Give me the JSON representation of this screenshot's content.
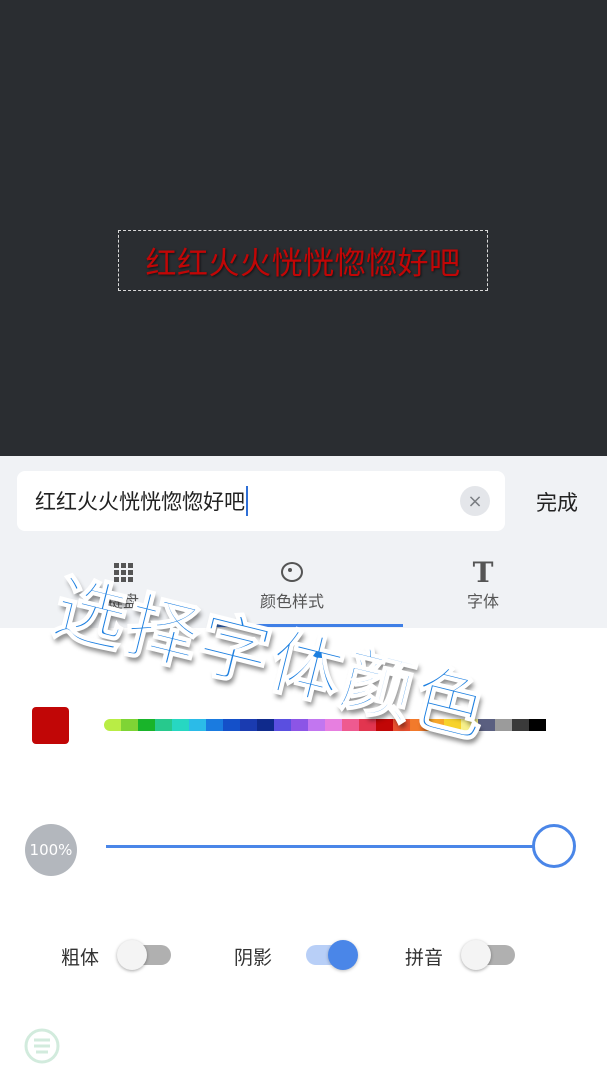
{
  "preview": {
    "text": "红红火火恍恍惚惚好吧",
    "text_color": "#c10606"
  },
  "editor": {
    "input_value": "红红火火恍恍惚惚好吧",
    "clear_icon": "×",
    "done_label": "完成",
    "tabs": [
      {
        "label": "键盘",
        "icon": "keyboard-icon"
      },
      {
        "label": "颜色样式",
        "icon": "palette-icon",
        "active": true
      },
      {
        "label": "字体",
        "icon": "font-icon",
        "glyph": "T"
      }
    ]
  },
  "style": {
    "selected_color": "#c10606",
    "palette": [
      "#b9ed45",
      "#7fd435",
      "#19b42a",
      "#27c98d",
      "#27d7c2",
      "#2bbbe8",
      "#1a7be0",
      "#1450c9",
      "#1a3bb0",
      "#0f2a8c",
      "#5a4fe0",
      "#8c55e6",
      "#c276f0",
      "#e77fe0",
      "#ee5a90",
      "#e2354f",
      "#c10606",
      "#e8502f",
      "#f27a2b",
      "#f7a529",
      "#f7d22a",
      "#f7f08a",
      "#5a5f80",
      "#9b9b9b",
      "#3a3a3a",
      "#000000"
    ],
    "opacity": "100%",
    "toggles": [
      {
        "label": "粗体",
        "on": false
      },
      {
        "label": "阴影",
        "on": true
      },
      {
        "label": "拼音",
        "on": false
      }
    ]
  },
  "overlay": {
    "caption": "选择字体颜色"
  }
}
